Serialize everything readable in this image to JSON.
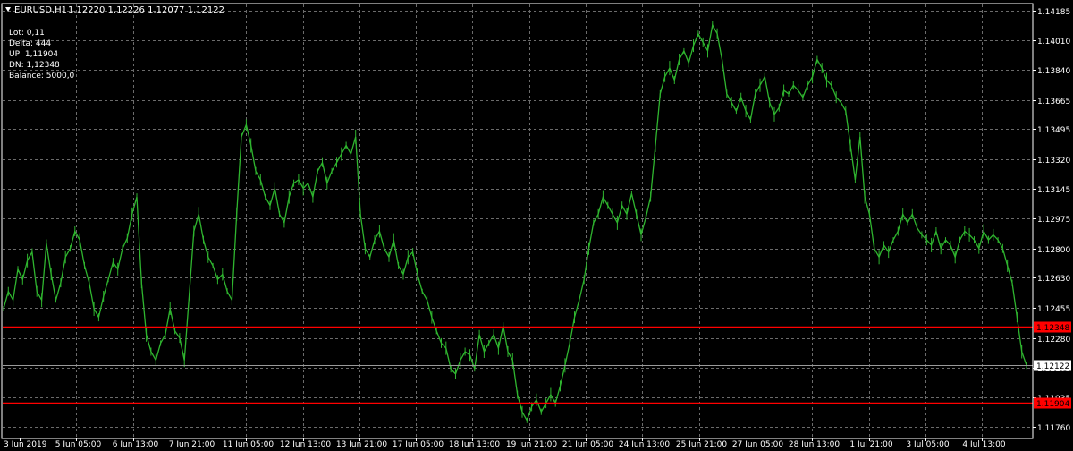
{
  "window": {
    "title": "EURUSD,H1",
    "ohlc": "1,12220 1,12226 1,12077 1,12122",
    "menu_icon": "triangle-down-icon"
  },
  "info_panel": {
    "lines": [
      "Lot: 0,11",
      "Delta: 444",
      "UP: 1,11904",
      "DN: 1,12348",
      "Balance: 5000,0"
    ]
  },
  "colors": {
    "background": "#000000",
    "grid": "#6b6b6b",
    "candles": "#2fb52f",
    "line_red": "#ff0000",
    "text": "#ffffff",
    "current_price_label_bg": "#ffffff",
    "current_price_label_fg": "#000000"
  },
  "chart_data": {
    "type": "line",
    "title": "EURUSD,H1",
    "symbol": "EURUSD",
    "timeframe": "H1",
    "ylim": [
      1.117,
      1.1422
    ],
    "yticks": [
      "1.14185",
      "1.14010",
      "1.13840",
      "1.13665",
      "1.13495",
      "1.13320",
      "1.13145",
      "1.12975",
      "1.12800",
      "1.12630",
      "1.12455",
      "1.12280",
      "1.12105",
      "1.11935",
      "1.11760"
    ],
    "xticks": [
      "3 Jun 2019",
      "5 Jun 05:00",
      "6 Jun 13:00",
      "7 Jun 21:00",
      "11 Jun 05:00",
      "12 Jun 13:00",
      "13 Jun 21:00",
      "17 Jun 05:00",
      "18 Jun 13:00",
      "19 Jun 21:00",
      "21 Jun 05:00",
      "24 Jun 13:00",
      "25 Jun 21:00",
      "27 Jun 05:00",
      "28 Jun 13:00",
      "1 Jul 21:00",
      "3 Jul 05:00",
      "4 Jul 13:00"
    ],
    "grid": true,
    "horizontal_lines": [
      {
        "name": "DN",
        "price": 1.12348,
        "label": "1.12348",
        "color": "#ff0000"
      },
      {
        "name": "UP",
        "price": 1.11904,
        "label": "1.11904",
        "color": "#ff0000"
      }
    ],
    "current_price": {
      "price": 1.12122,
      "label": "1.12122"
    },
    "series": [
      {
        "values": [
          1.1245,
          1.1255,
          1.125,
          1.1268,
          1.1262,
          1.1273,
          1.1278,
          1.1255,
          1.125,
          1.1283,
          1.1265,
          1.125,
          1.126,
          1.1275,
          1.128,
          1.129,
          1.1285,
          1.127,
          1.126,
          1.1245,
          1.124,
          1.1252,
          1.1262,
          1.1272,
          1.1268,
          1.128,
          1.1286,
          1.13,
          1.131,
          1.126,
          1.123,
          1.122,
          1.1215,
          1.1225,
          1.123,
          1.1245,
          1.1232,
          1.1228,
          1.1215,
          1.1252,
          1.129,
          1.13,
          1.1285,
          1.1275,
          1.127,
          1.1262,
          1.1265,
          1.1255,
          1.125,
          1.13,
          1.1345,
          1.1352,
          1.134,
          1.1325,
          1.132,
          1.131,
          1.1305,
          1.1315,
          1.13,
          1.1295,
          1.131,
          1.1318,
          1.132,
          1.1315,
          1.1318,
          1.131,
          1.1325,
          1.133,
          1.1318,
          1.1325,
          1.133,
          1.1335,
          1.134,
          1.1335,
          1.1345,
          1.13,
          1.128,
          1.1275,
          1.1285,
          1.129,
          1.128,
          1.1275,
          1.1285,
          1.127,
          1.1265,
          1.1275,
          1.1278,
          1.1265,
          1.1255,
          1.125,
          1.124,
          1.1232,
          1.1225,
          1.1222,
          1.121,
          1.1207,
          1.1215,
          1.122,
          1.1218,
          1.121,
          1.123,
          1.122,
          1.1225,
          1.123,
          1.1222,
          1.1235,
          1.122,
          1.1215,
          1.1195,
          1.1185,
          1.118,
          1.1188,
          1.1192,
          1.1185,
          1.119,
          1.1195,
          1.119,
          1.12,
          1.1212,
          1.1225,
          1.124,
          1.125,
          1.1262,
          1.128,
          1.1295,
          1.13,
          1.131,
          1.1305,
          1.13,
          1.1295,
          1.1305,
          1.13,
          1.1312,
          1.13,
          1.1288,
          1.1298,
          1.131,
          1.134,
          1.137,
          1.138,
          1.1385,
          1.1378,
          1.139,
          1.1395,
          1.1388,
          1.1398,
          1.1405,
          1.14,
          1.1395,
          1.141,
          1.1405,
          1.139,
          1.137,
          1.1365,
          1.136,
          1.1368,
          1.136,
          1.1355,
          1.137,
          1.1375,
          1.138,
          1.1365,
          1.1358,
          1.1362,
          1.1372,
          1.137,
          1.1375,
          1.1372,
          1.1368,
          1.1375,
          1.138,
          1.139,
          1.1385,
          1.1378,
          1.1375,
          1.1368,
          1.1365,
          1.136,
          1.134,
          1.132,
          1.1345,
          1.131,
          1.13,
          1.128,
          1.1275,
          1.1282,
          1.1278,
          1.1285,
          1.129,
          1.13,
          1.1295,
          1.13,
          1.1292,
          1.1288,
          1.1285,
          1.1282,
          1.129,
          1.128,
          1.1285,
          1.1282,
          1.1275,
          1.1285,
          1.129,
          1.1288,
          1.1285,
          1.128,
          1.129,
          1.1285,
          1.1288,
          1.1285,
          1.128,
          1.127,
          1.126,
          1.124,
          1.122,
          1.1212
        ]
      }
    ]
  }
}
